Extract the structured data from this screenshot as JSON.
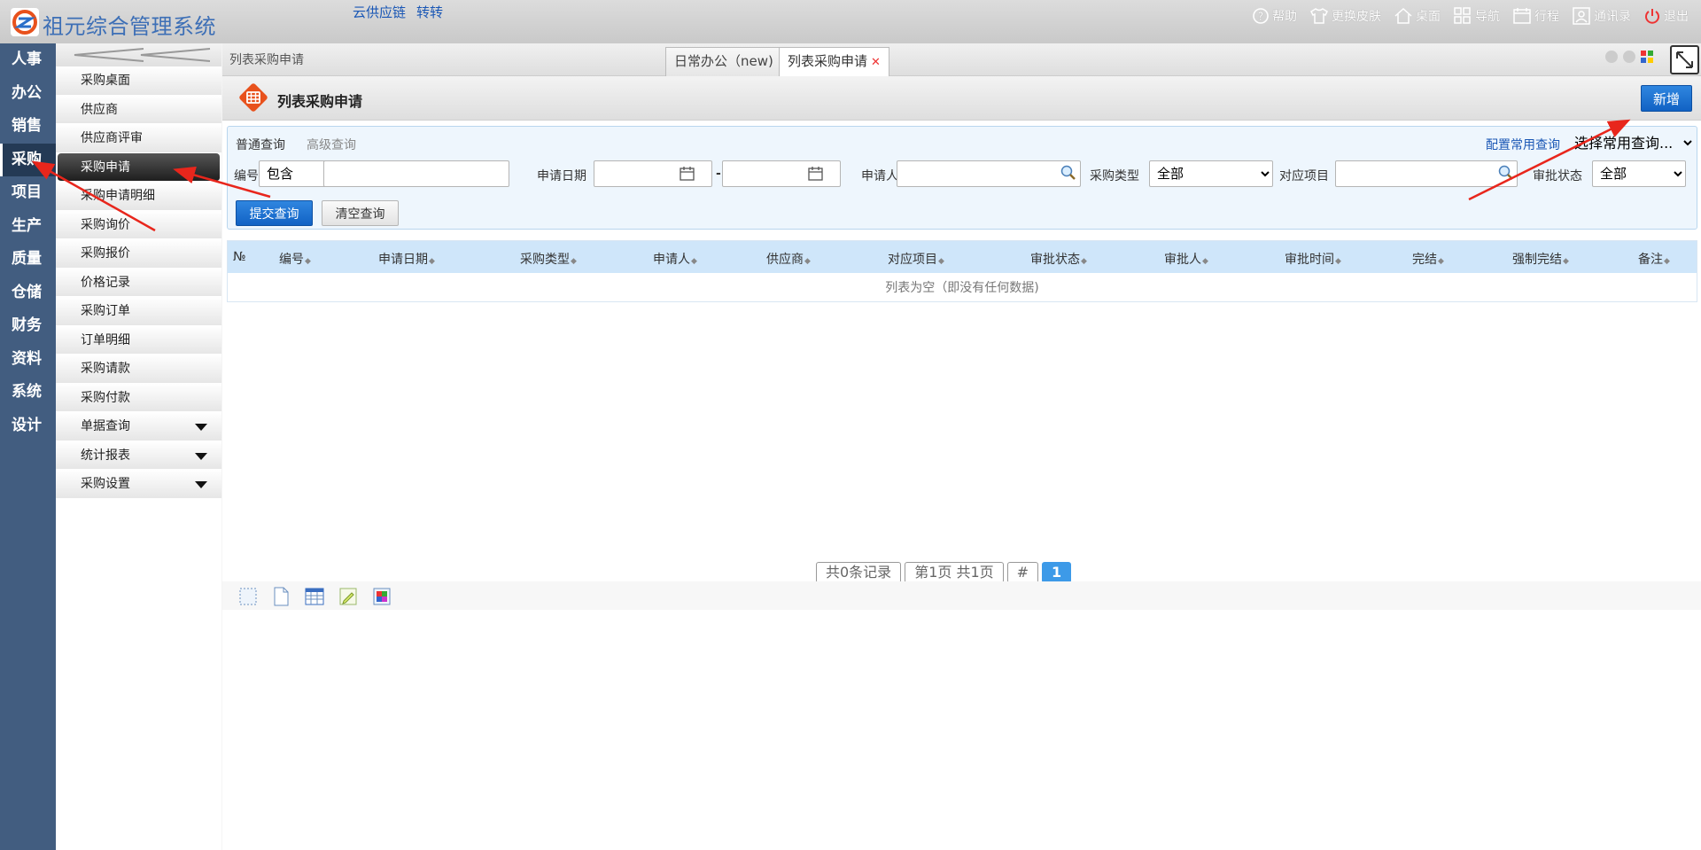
{
  "header": {
    "app_title": "祖元综合管理系统",
    "links": [
      "云供应链",
      "转转"
    ],
    "tools": [
      {
        "label": "帮助",
        "icon": "help-icon"
      },
      {
        "label": "更换皮肤",
        "icon": "tshirt-icon"
      },
      {
        "label": "桌面",
        "icon": "home-icon"
      },
      {
        "label": "导航",
        "icon": "grid-icon"
      },
      {
        "label": "行程",
        "icon": "calendar-icon"
      },
      {
        "label": "通讯录",
        "icon": "contact-icon"
      },
      {
        "label": "退出",
        "icon": "power-icon"
      }
    ]
  },
  "nav": {
    "items": [
      "人事",
      "办公",
      "销售",
      "采购",
      "项目",
      "生产",
      "质量",
      "仓储",
      "财务",
      "资料",
      "系统",
      "设计"
    ],
    "active": "采购"
  },
  "submenu": {
    "items": [
      {
        "label": "采购桌面"
      },
      {
        "label": "供应商"
      },
      {
        "label": "供应商评审"
      },
      {
        "label": "采购申请",
        "active": true
      },
      {
        "label": "采购申请明细"
      },
      {
        "label": "采购询价"
      },
      {
        "label": "采购报价"
      },
      {
        "label": "价格记录"
      },
      {
        "label": "采购订单"
      },
      {
        "label": "订单明细"
      },
      {
        "label": "采购请款"
      },
      {
        "label": "采购付款"
      },
      {
        "label": "单据查询",
        "expandable": true
      },
      {
        "label": "统计报表",
        "expandable": true
      },
      {
        "label": "采购设置",
        "expandable": true
      }
    ]
  },
  "tabs": {
    "breadcrumb": "列表采购申请",
    "items": [
      {
        "label": "日常办公（new)",
        "active": false
      },
      {
        "label": "列表采购申请",
        "active": true
      }
    ]
  },
  "page": {
    "title": "列表采购申请",
    "add_label": "新增"
  },
  "query": {
    "tab_normal": "普通查询",
    "tab_advanced": "高级查询",
    "config_link": "配置常用查询",
    "common_select": "选择常用查询...",
    "fields": {
      "code_label": "编号",
      "code_op": "包含",
      "date_label": "申请日期",
      "date_sep": "-",
      "applicant_label": "申请人",
      "type_label": "采购类型",
      "type_value": "全部",
      "project_label": "对应项目",
      "status_label": "审批状态",
      "status_value": "全部"
    },
    "submit_label": "提交查询",
    "clear_label": "清空查询"
  },
  "grid": {
    "columns": [
      "№",
      "编号",
      "申请日期",
      "采购类型",
      "申请人",
      "供应商",
      "对应项目",
      "审批状态",
      "审批人",
      "审批时间",
      "完结",
      "强制完结",
      "备注"
    ],
    "empty_text": "列表为空（即没有任何数据)"
  },
  "pager": {
    "total": "共0条记录",
    "pages": "第1页 共1页",
    "hash": "#",
    "current": "1"
  },
  "colors": {
    "nav_bg": "#425d80",
    "accent": "#1a6fd4",
    "header_bg": "#d3d3d3",
    "arrow": "#e8261c"
  }
}
